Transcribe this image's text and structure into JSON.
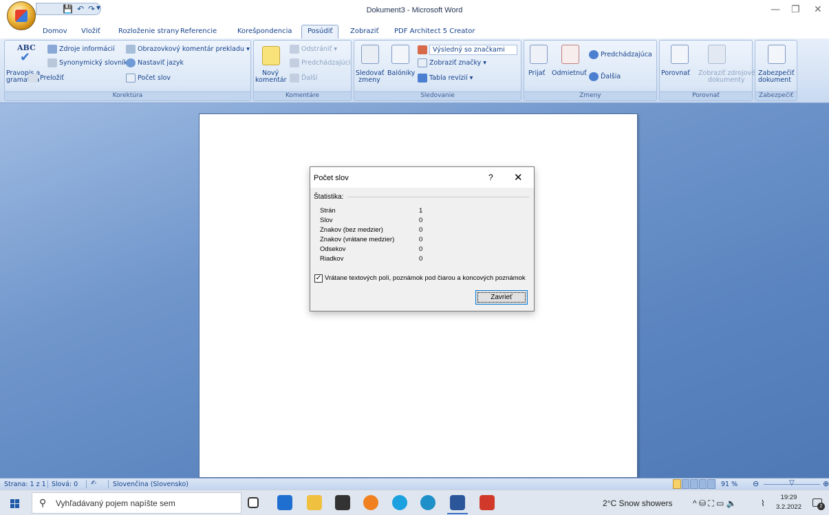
{
  "window": {
    "title": "Dokument3 - Microsoft Word",
    "minimize": "—",
    "maximize": "❐",
    "close": "✕"
  },
  "qat": {
    "save": "💾",
    "undo": "↶",
    "redo": "↷",
    "more": "▾"
  },
  "tabs": [
    "Domov",
    "Vložiť",
    "Rozloženie strany",
    "Referencie",
    "Korešpondencia",
    "Posúdiť",
    "Zobraziť",
    "PDF Architect 5 Creator"
  ],
  "active_tab": "Posúdiť",
  "ribbon": {
    "korektura": {
      "label": "Korektúra",
      "pravopis_line1": "Pravopis a",
      "pravopis_line2": "gramatika",
      "abc": "ABC",
      "zdroje": "Zdroje informácií",
      "synonymicky": "Synonymický slovník",
      "prelozit": "Preložiť",
      "obrazovkovy": "Obrazovkový komentár prekladu",
      "nastavit_jazyk": "Nastaviť jazyk",
      "pocet_slov": "Počet slov"
    },
    "komentare": {
      "label": "Komentáre",
      "novy_line1": "Nový",
      "novy_line2": "komentár",
      "odstranit": "Odstrániť",
      "predchadzajuci": "Predchádzajúci",
      "dalsi": "Ďalší"
    },
    "sledovanie": {
      "label": "Sledovanie",
      "sledovat_line1": "Sledovať",
      "sledovat_line2": "zmeny",
      "balon_line1": "Balóniky",
      "vysledny": "Výsledný so značkami",
      "zobrazit_znacky": "Zobraziť značky",
      "tabla": "Tabla revízií"
    },
    "zmeny": {
      "label": "Zmeny",
      "prijat": "Prijať",
      "odmietnut": "Odmietnuť",
      "predchadzajuca": "Predchádzajúca",
      "dalsia": "Ďalšia"
    },
    "porovnat": {
      "label": "Porovnať",
      "porovnat_btn": "Porovnať",
      "zobrazit_line1": "Zobraziť zdrojové",
      "zobrazit_line2": "dokumenty"
    },
    "zabezpecit": {
      "label": "Zabezpečiť",
      "btn_line1": "Zabezpečiť",
      "btn_line2": "dokument"
    }
  },
  "dialog": {
    "title": "Počet slov",
    "help": "?",
    "close": "✕",
    "stats_header": "Štatistika:",
    "rows": [
      {
        "label": "Strán",
        "value": "1"
      },
      {
        "label": "Slov",
        "value": "0"
      },
      {
        "label": "Znakov (bez medzier)",
        "value": "0"
      },
      {
        "label": "Znakov (vrátane medzier)",
        "value": "0"
      },
      {
        "label": "Odsekov",
        "value": "0"
      },
      {
        "label": "Riadkov",
        "value": "0"
      }
    ],
    "checkbox_mark": "✓",
    "checkbox_label": "Vrátane textových polí, poznámok pod čiarou a koncových poznámok",
    "checkbox_checked": true,
    "close_button": "Zavrieť"
  },
  "statusbar": {
    "page": "Strana: 1 z 1",
    "words": "Slová: 0",
    "language": "Slovenčina (Slovensko)",
    "zoom": "91 %",
    "zoom_out": "⊖",
    "zoom_in": "⊕"
  },
  "taskbar": {
    "search_placeholder": "Vyhľadávaný pojem napíšte sem",
    "search_icon": "⚲",
    "weather": "2°C  Snow showers",
    "tray_icons": "^  ⛁  ⛶  ▭  🔈",
    "wifi": "⌇",
    "time": "19:29",
    "date": "3.2.2022",
    "notification_count": "2"
  },
  "colors": {
    "ribbon_text": "#15428b",
    "doc_background": "#6e8fbf",
    "accent": "#0078d7"
  }
}
